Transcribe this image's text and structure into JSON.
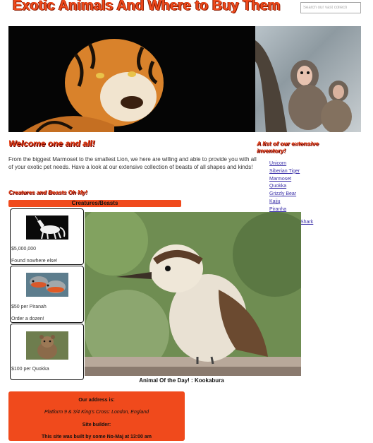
{
  "header": {
    "title": "Exotic Animals And Where to Buy Them",
    "search_placeholder": "Search our vast collecti"
  },
  "banner": {
    "left_image": "tiger-photo",
    "right_image": "marmosets-photo"
  },
  "welcome": {
    "heading": "Welcome one and all!",
    "text": "From the biggest Marmoset to the smallest Lion, we here are willing and able to provide you with all of your exotic pet needs. Have a look at our extensive collection of beasts of all shapes and kinds!"
  },
  "creatures": {
    "heading": "Creatures and Beasts Oh My!",
    "tab_label": "Creatures/Beasts",
    "cards": [
      {
        "image": "unicorn-photo",
        "price": "$5,000,000",
        "note": "Found nowhere else!"
      },
      {
        "image": "piranhas-photo",
        "price": "$50 per Piranah",
        "note": "Order a dozen!"
      },
      {
        "image": "quokka-photo",
        "price": "$100 per Quokka",
        "note": ""
      }
    ]
  },
  "inventory": {
    "heading": "A list of our extensive inventory!",
    "items": [
      "Unicorn",
      "Siberian Tiger",
      "Marmoset",
      "Quokka",
      "Grizzly Bear",
      "Kaiju",
      "Piranha"
    ],
    "extra_item": "Shark"
  },
  "feature": {
    "image": "kookaburra-photo",
    "caption": "Animal Of the Day! : Kookabura"
  },
  "footer": {
    "address_label": "Our address is:",
    "address": "Platform 9 & 3/4 King's Cross: London, England",
    "builder_label": "Site builder:",
    "builder_text": "This site was built by some No-Maj at 13:00 am"
  },
  "colors": {
    "accent": "#f04a1c",
    "link": "#3a2fa8"
  }
}
